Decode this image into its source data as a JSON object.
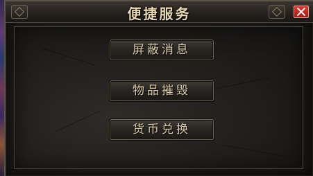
{
  "window": {
    "title": "便捷服务"
  },
  "buttons": {
    "block_messages": "屏蔽消息",
    "destroy_items": "物品摧毁",
    "currency_exchange": "货币兑换"
  },
  "icons": {
    "close": "close-icon"
  },
  "colors": {
    "title_text": "#e8d9b0",
    "button_text": "#d8cba6",
    "close_button": "#c4201a",
    "panel_bg": "#1f1d1b"
  }
}
